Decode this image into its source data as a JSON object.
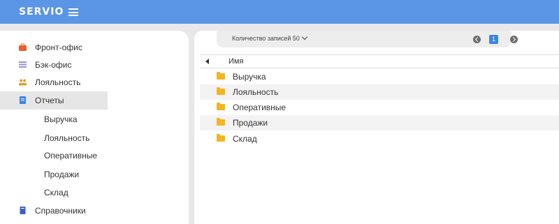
{
  "header": {
    "brand": "SERVIO"
  },
  "sidebar": {
    "items": [
      {
        "label": "Фронт-офис",
        "icon": "briefcase-icon",
        "color": "#e8612c"
      },
      {
        "label": "Бэк-офис",
        "icon": "list-icon",
        "color": "#9b8fd8"
      },
      {
        "label": "Лояльность",
        "icon": "people-icon",
        "color": "#e0a030"
      },
      {
        "label": "Отчеты",
        "icon": "report-icon",
        "color": "#3a86e0",
        "active": true
      },
      {
        "label": "Справочники",
        "icon": "book-icon",
        "color": "#3a60c8"
      }
    ],
    "subitems": [
      "Выручка",
      "Лояльность",
      "Оперативные",
      "Продажи",
      "Склад"
    ]
  },
  "toolbar": {
    "records_label": "Количество записей 50",
    "current_page": "1"
  },
  "table": {
    "column_name": "Имя",
    "rows": [
      "Выручка",
      "Лояльность",
      "Оперативные",
      "Продажи",
      "Склад"
    ]
  },
  "colors": {
    "accent": "#5b95e5",
    "folder": "#f4b521",
    "page_active": "#3a86e0"
  }
}
